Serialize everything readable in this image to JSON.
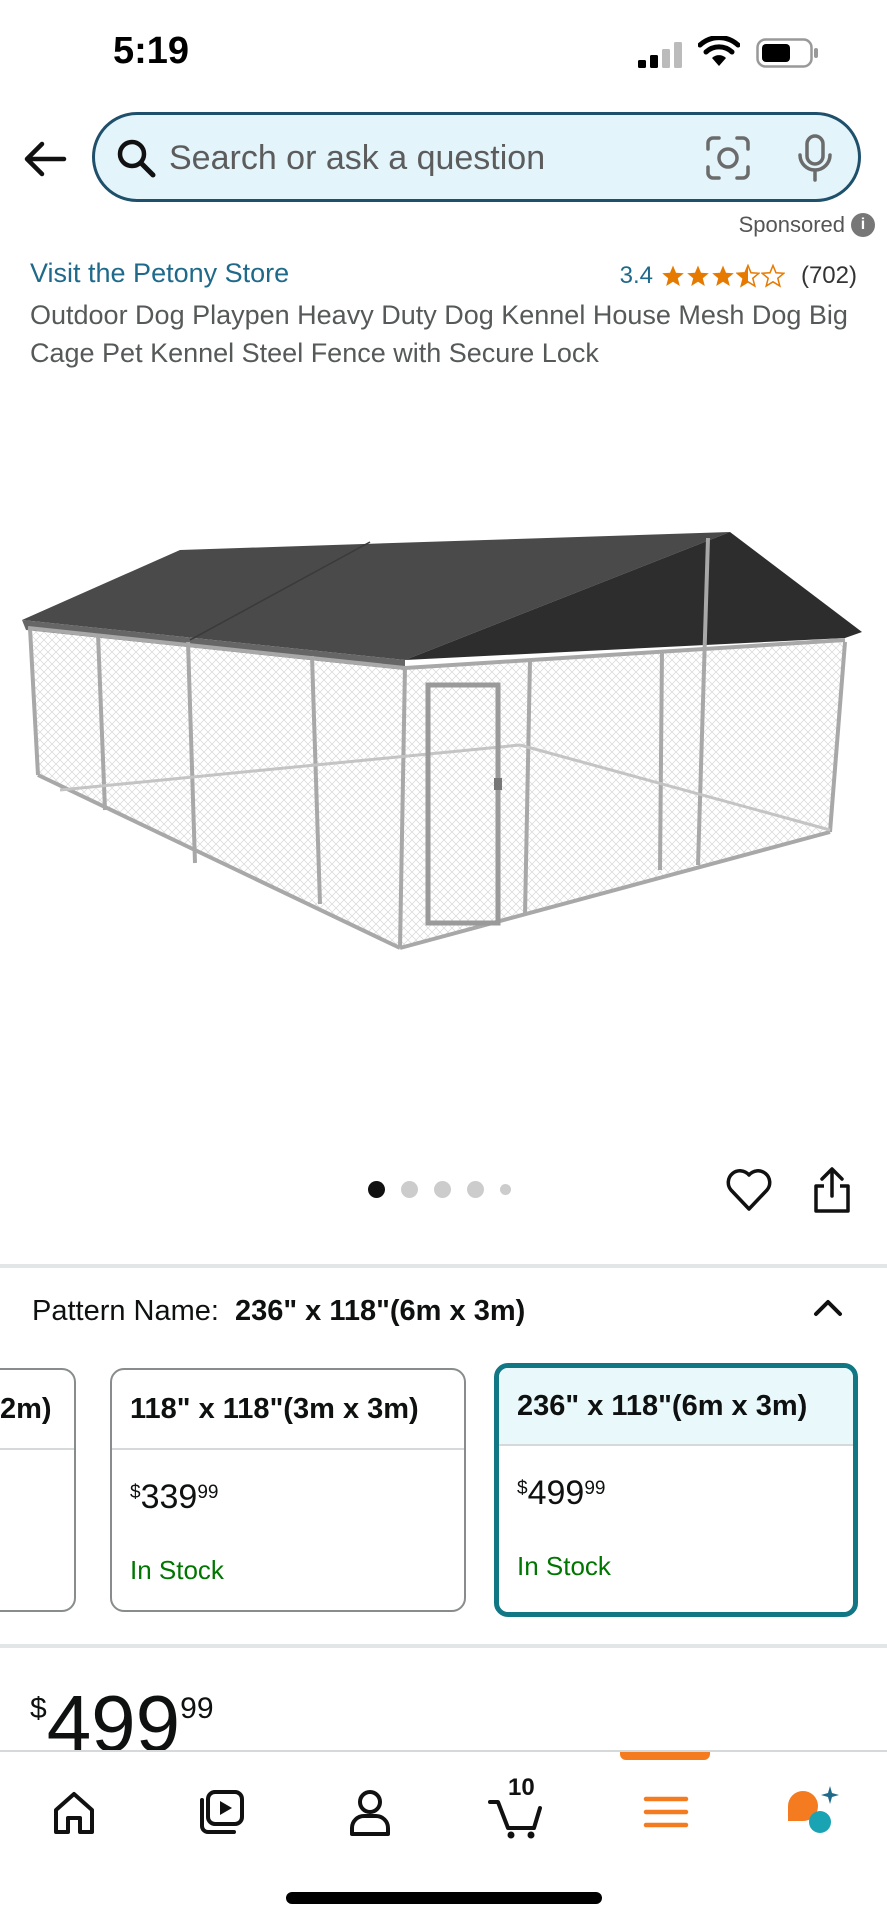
{
  "status_bar": {
    "time": "5:19"
  },
  "search": {
    "placeholder": "Search or ask a question"
  },
  "sponsored_label": "Sponsored",
  "product": {
    "store_link": "Visit the Petony Store",
    "rating": "3.4",
    "rating_value": 3.4,
    "review_count": "(702)",
    "title": "Outdoor Dog Playpen Heavy Duty Dog Kennel House Mesh Dog Big Cage Pet Kennel Steel Fence with Secure Lock"
  },
  "gallery": {
    "total_images": 5,
    "active_index": 0
  },
  "pattern": {
    "label": "Pattern Name:",
    "selected": "236\" x 118\"(6m x 3m)",
    "options": [
      {
        "name": "2m)",
        "price_symbol": "",
        "price_dollars": "",
        "price_cents": "",
        "stock": ""
      },
      {
        "name": "118\" x 118\"(3m x 3m)",
        "price_symbol": "$",
        "price_dollars": "339",
        "price_cents": "99",
        "stock": "In Stock"
      },
      {
        "name": "236\" x 118\"(6m x 3m)",
        "price_symbol": "$",
        "price_dollars": "499",
        "price_cents": "99",
        "stock": "In Stock"
      }
    ]
  },
  "price": {
    "symbol": "$",
    "dollars": "499",
    "cents": "99"
  },
  "bottom_nav": {
    "items": [
      "home",
      "inspire",
      "account",
      "cart",
      "menu",
      "rufus"
    ],
    "cart_count": "10",
    "active": "menu"
  },
  "colors": {
    "link": "#1f6a8a",
    "star": "#e67a00",
    "in_stock": "#007600",
    "selected_border": "#127785",
    "accent": "#f47b20"
  }
}
